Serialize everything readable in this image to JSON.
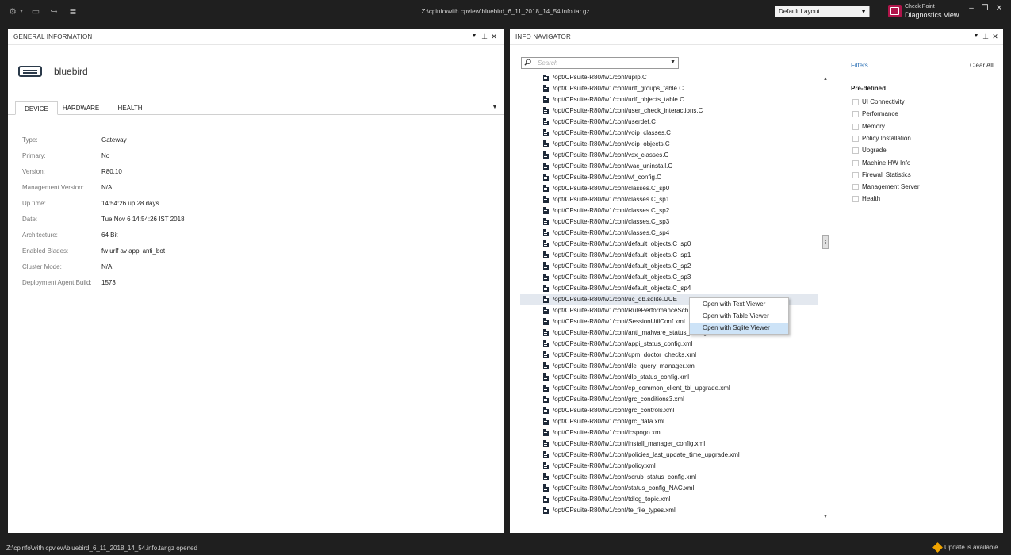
{
  "window": {
    "title": "Z:\\cpinfo\\with cpview\\bluebird_6_11_2018_14_54.info.tar.gz",
    "layout_select": "Default Layout",
    "brand_line1": "Check Point",
    "brand_line2": "Diagnostics View"
  },
  "general_info": {
    "title": "GENERAL INFORMATION",
    "device_name": "bluebird",
    "tabs": [
      "DEVICE",
      "HARDWARE",
      "HEALTH"
    ],
    "rows": [
      {
        "label": "Type:",
        "value": "Gateway"
      },
      {
        "label": "Primary:",
        "value": "No"
      },
      {
        "label": "Version:",
        "value": "R80.10"
      },
      {
        "label": "Management Version:",
        "value": "N/A"
      },
      {
        "label": "Up time:",
        "value": "14:54:26 up 28 days"
      },
      {
        "label": "Date:",
        "value": "Tue Nov  6 14:54:26 IST 2018"
      },
      {
        "label": "Architecture:",
        "value": "64 Bit"
      },
      {
        "label": "Enabled Blades:",
        "value": "fw urlf av appi anti_bot"
      },
      {
        "label": "Cluster Mode:",
        "value": "N/A"
      },
      {
        "label": "Deployment Agent Build:",
        "value": "1573"
      }
    ]
  },
  "info_navigator": {
    "title": "INFO NAVIGATOR",
    "search_placeholder": "Search",
    "files": [
      "/opt/CPsuite-R80/fw1/conf/upIp.C",
      "/opt/CPsuite-R80/fw1/conf/urlf_groups_table.C",
      "/opt/CPsuite-R80/fw1/conf/urlf_objects_table.C",
      "/opt/CPsuite-R80/fw1/conf/user_check_interactions.C",
      "/opt/CPsuite-R80/fw1/conf/userdef.C",
      "/opt/CPsuite-R80/fw1/conf/voip_classes.C",
      "/opt/CPsuite-R80/fw1/conf/voip_objects.C",
      "/opt/CPsuite-R80/fw1/conf/vsx_classes.C",
      "/opt/CPsuite-R80/fw1/conf/wac_uninstall.C",
      "/opt/CPsuite-R80/fw1/conf/wf_config.C",
      "/opt/CPsuite-R80/fw1/conf/classes.C_sp0",
      "/opt/CPsuite-R80/fw1/conf/classes.C_sp1",
      "/opt/CPsuite-R80/fw1/conf/classes.C_sp2",
      "/opt/CPsuite-R80/fw1/conf/classes.C_sp3",
      "/opt/CPsuite-R80/fw1/conf/classes.C_sp4",
      "/opt/CPsuite-R80/fw1/conf/default_objects.C_sp0",
      "/opt/CPsuite-R80/fw1/conf/default_objects.C_sp1",
      "/opt/CPsuite-R80/fw1/conf/default_objects.C_sp2",
      "/opt/CPsuite-R80/fw1/conf/default_objects.C_sp3",
      "/opt/CPsuite-R80/fw1/conf/default_objects.C_sp4",
      "/opt/CPsuite-R80/fw1/conf/uc_db.sqlite.UUE",
      "/opt/CPsuite-R80/fw1/conf/RulePerformanceSch",
      "/opt/CPsuite-R80/fw1/conf/SessionUtilConf.xml",
      "/opt/CPsuite-R80/fw1/conf/anti_malware_status_config.xml",
      "/opt/CPsuite-R80/fw1/conf/appi_status_config.xml",
      "/opt/CPsuite-R80/fw1/conf/cpm_doctor_checks.xml",
      "/opt/CPsuite-R80/fw1/conf/dle_query_manager.xml",
      "/opt/CPsuite-R80/fw1/conf/dlp_status_config.xml",
      "/opt/CPsuite-R80/fw1/conf/ep_common_client_tbl_upgrade.xml",
      "/opt/CPsuite-R80/fw1/conf/grc_conditions3.xml",
      "/opt/CPsuite-R80/fw1/conf/grc_controls.xml",
      "/opt/CPsuite-R80/fw1/conf/grc_data.xml",
      "/opt/CPsuite-R80/fw1/conf/icspogo.xml",
      "/opt/CPsuite-R80/fw1/conf/install_manager_config.xml",
      "/opt/CPsuite-R80/fw1/conf/policies_last_update_time_upgrade.xml",
      "/opt/CPsuite-R80/fw1/conf/policy.xml",
      "/opt/CPsuite-R80/fw1/conf/scrub_status_config.xml",
      "/opt/CPsuite-R80/fw1/conf/status_config_NAC.xml",
      "/opt/CPsuite-R80/fw1/conf/tdlog_topic.xml",
      "/opt/CPsuite-R80/fw1/conf/te_file_types.xml"
    ],
    "filters_label": "Filters",
    "clear_all_label": "Clear All",
    "predefined_label": "Pre-defined",
    "filters": [
      "UI Connectivity",
      "Performance",
      "Memory",
      "Policy Installation",
      "Upgrade",
      "Machine HW Info",
      "Firewall Statistics",
      "Management Server",
      "Health"
    ]
  },
  "context_menu": {
    "items": [
      "Open with Text Viewer",
      "Open with Table Viewer",
      "Open with Sqlite Viewer"
    ]
  },
  "status_bar": {
    "text": "Z:\\cpinfo\\with cpview\\bluebird_6_11_2018_14_54.info.tar.gz opened",
    "update_text": "Update is available"
  }
}
